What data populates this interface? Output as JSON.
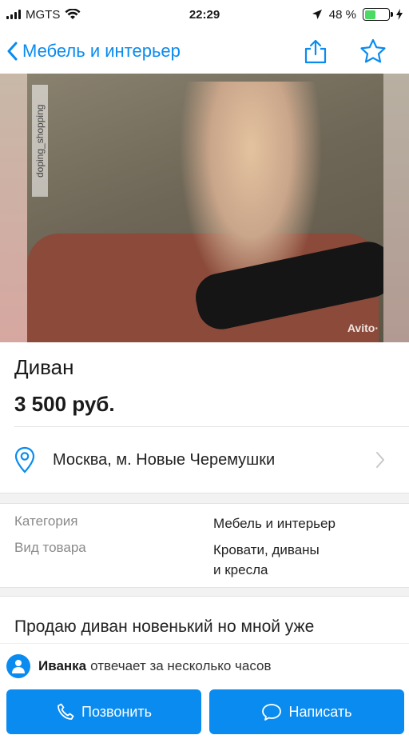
{
  "status_bar": {
    "carrier": "MGTS",
    "time": "22:29",
    "battery_percent": "48 %",
    "battery_level": 0.48,
    "icons": [
      "signal-icon",
      "wifi-icon",
      "location-arrow-icon",
      "battery-icon",
      "charging-icon"
    ]
  },
  "nav": {
    "back_label": "Мебель и интерьер",
    "icons": [
      "chevron-left-icon",
      "share-icon",
      "star-icon"
    ]
  },
  "photo": {
    "watermark_vertical": "doping_shopping",
    "watermark_logo": "Avito·"
  },
  "listing": {
    "title": "Диван",
    "price": "3 500 руб."
  },
  "location": {
    "text": "Москва, м. Новые Черемушки"
  },
  "params": [
    {
      "label": "Категория",
      "value_lines": [
        "Мебель и интерьер"
      ]
    },
    {
      "label": "Вид товара",
      "value_lines": [
        "Кровати, диваны",
        "и кресла"
      ]
    }
  ],
  "description": "Продаю диван новенький но мной уже",
  "seller": {
    "name": "Иванка",
    "response": "отвечает за несколько часов"
  },
  "buttons": {
    "call": "Позвонить",
    "message": "Написать"
  },
  "colors": {
    "accent": "#0a8bef",
    "battery": "#4cd964"
  }
}
